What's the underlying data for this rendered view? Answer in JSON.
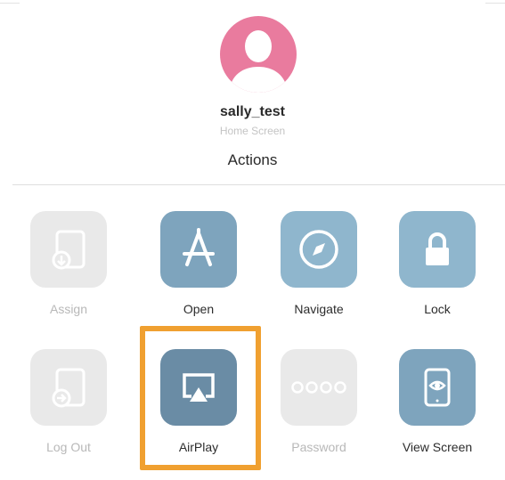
{
  "header": {
    "username": "sally_test",
    "subtitle": "Home Screen",
    "section_title": "Actions"
  },
  "actions": [
    {
      "label": "Assign",
      "icon": "tablet-download-icon",
      "enabled": false
    },
    {
      "label": "Open",
      "icon": "app-store-icon",
      "enabled": true
    },
    {
      "label": "Navigate",
      "icon": "compass-icon",
      "enabled": true
    },
    {
      "label": "Lock",
      "icon": "lock-icon",
      "enabled": true
    },
    {
      "label": "Log Out",
      "icon": "tablet-logout-icon",
      "enabled": false
    },
    {
      "label": "AirPlay",
      "icon": "airplay-icon",
      "enabled": true,
      "highlighted": true
    },
    {
      "label": "Password",
      "icon": "passcode-dots-icon",
      "enabled": false
    },
    {
      "label": "View Screen",
      "icon": "tablet-eye-icon",
      "enabled": true
    }
  ],
  "colors": {
    "avatar": "#e97b9e",
    "highlight": "#f0a030",
    "tile_disabled": "#e9e9e9",
    "tile_enabled": "#7ea4bd"
  }
}
